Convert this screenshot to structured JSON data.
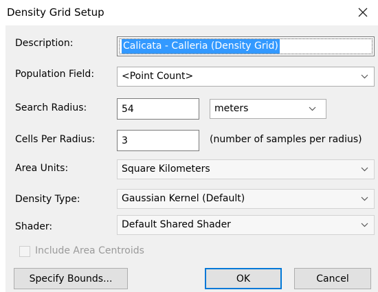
{
  "window": {
    "title": "Density Grid Setup",
    "close_label": "✕"
  },
  "form": {
    "description": {
      "label": "Description:",
      "value": "Calicata - Calleria (Density Grid)"
    },
    "population_field": {
      "label": "Population Field:",
      "value": "<Point Count>"
    },
    "search_radius": {
      "label": "Search Radius:",
      "value": "54",
      "unit": "meters"
    },
    "cells_per_radius": {
      "label": "Cells Per Radius:",
      "value": "3",
      "note": "(number of samples per radius)"
    },
    "area_units": {
      "label": "Area Units:",
      "value": "Square Kilometers"
    },
    "density_type": {
      "label": "Density Type:",
      "value": "Gaussian Kernel (Default)"
    },
    "shader": {
      "label": "Shader:",
      "value": "Default Shared Shader"
    },
    "include_area_centroids": {
      "label": "Include Area Centroids",
      "checked": false,
      "disabled": true
    }
  },
  "buttons": {
    "specify_bounds": "Specify Bounds...",
    "ok": "OK",
    "cancel": "Cancel"
  },
  "icons": {
    "dropdown": "chevron-down-icon",
    "close": "close-icon"
  }
}
